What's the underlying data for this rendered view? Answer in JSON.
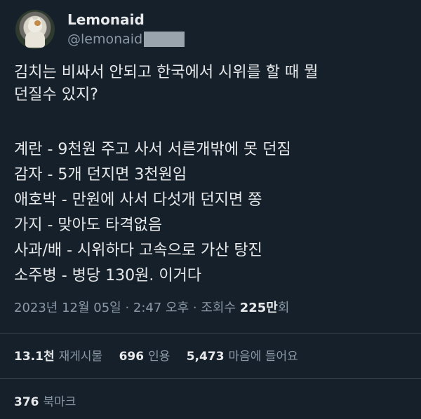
{
  "user": {
    "display_name": "Lemonaid",
    "handle": "@lemonaid"
  },
  "tweet": {
    "intro_lines": [
      "김치는 비싸서 안되고 한국에서 시위를 할 때 뭘",
      "던질수 있지?"
    ],
    "list_lines": [
      "계란 - 9천원 주고 사서 서른개밖에 못 던짐",
      "감자 - 5개 던지면 3천원임",
      "애호박 - 만원에 사서 다섯개 던지면 쫑",
      "가지 - 맞아도 타격없음",
      "사과/배 - 시위하다 고속으로 가산 탕진",
      "소주병 - 병당 130원. 이거다"
    ]
  },
  "meta": {
    "timestamp": "2023년 12월 05일 · 2:47 오후 · 조회수 ",
    "views_number": "225만",
    "views_suffix": "회"
  },
  "stats": {
    "retweets_count": "13.1천",
    "retweets_label": "재게시물",
    "quotes_count": "696",
    "quotes_label": "인용",
    "likes_count": "5,473",
    "likes_label": "마음에 들어요",
    "bookmarks_count": "376",
    "bookmarks_label": "북마크"
  }
}
